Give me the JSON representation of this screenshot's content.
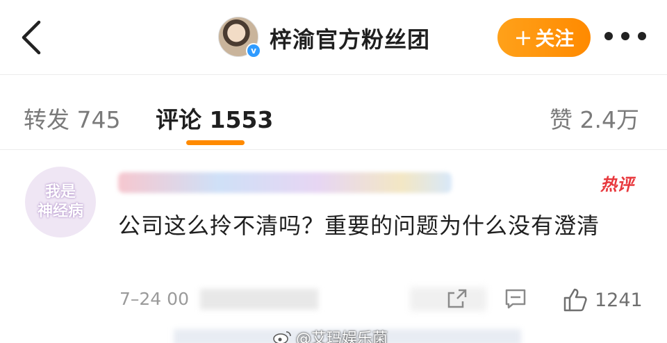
{
  "header": {
    "title": "梓渝官方粉丝团",
    "follow_label": "关注",
    "follow_plus": "+",
    "verified_mark": "v"
  },
  "tabs": {
    "forward": "转发 745",
    "comment": "评论 1553",
    "like": "赞 2.4万"
  },
  "comment": {
    "avatar_line1": "我是",
    "avatar_line2": "神经病",
    "badge": "热评",
    "text": "公司这么拎不清吗？重要的问题为什么没有澄清",
    "date": "7–24 00",
    "like_count": "1241"
  },
  "watermark": {
    "text": "@艾玛娱乐菌"
  },
  "colors": {
    "accent": "#ff8a00",
    "hot": "#e8383d",
    "verified": "#2f9bff"
  },
  "icons": [
    "back-chevron-icon",
    "more-dots-icon",
    "share-icon",
    "reply-icon",
    "thumbs-up-icon",
    "weibo-icon"
  ]
}
